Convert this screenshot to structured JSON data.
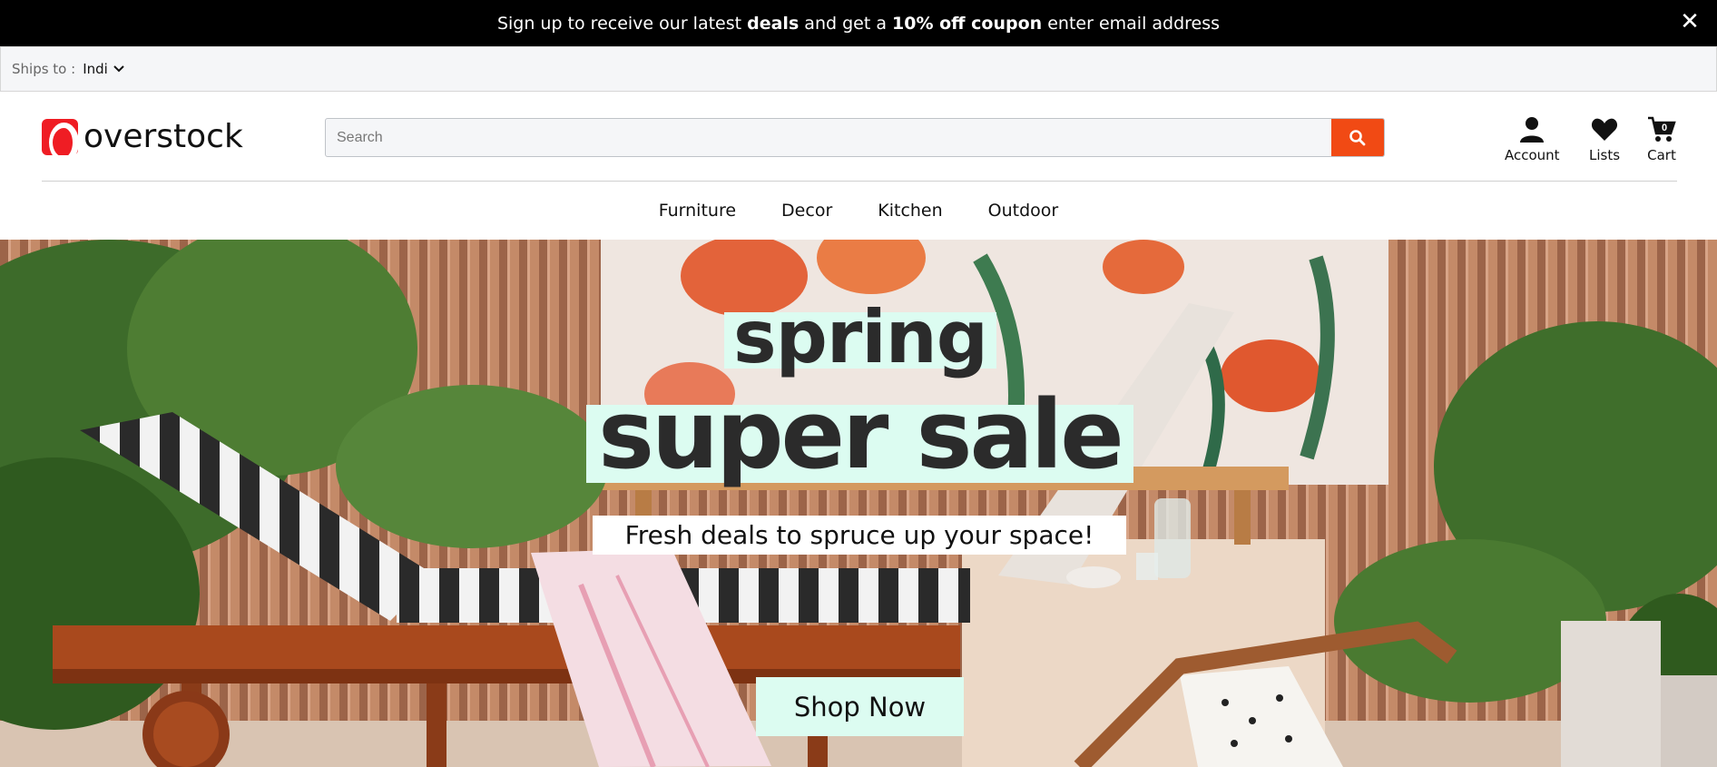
{
  "promo": {
    "text_1": "Sign up to receive our latest ",
    "bold_1": "deals",
    "text_2": " and get a ",
    "bold_2": "10% off coupon",
    "text_3": " enter email address",
    "close": "✕"
  },
  "ships": {
    "label": "Ships to :",
    "country": "Indi"
  },
  "header": {
    "logo_text": "overstock",
    "search_placeholder": "Search",
    "account_label": "Account",
    "lists_label": "Lists",
    "cart_label": "Cart",
    "cart_count": "0"
  },
  "nav": {
    "items": [
      "Furniture",
      "Decor",
      "Kitchen",
      "Outdoor"
    ]
  },
  "hero": {
    "line1": "spring",
    "line2": "super sale",
    "tagline": "Fresh deals to spruce up your space!",
    "cta": "Shop Now"
  },
  "colors": {
    "accent": "#f14a14",
    "brand": "#ef1d24",
    "mint": "#dcfcf1"
  }
}
